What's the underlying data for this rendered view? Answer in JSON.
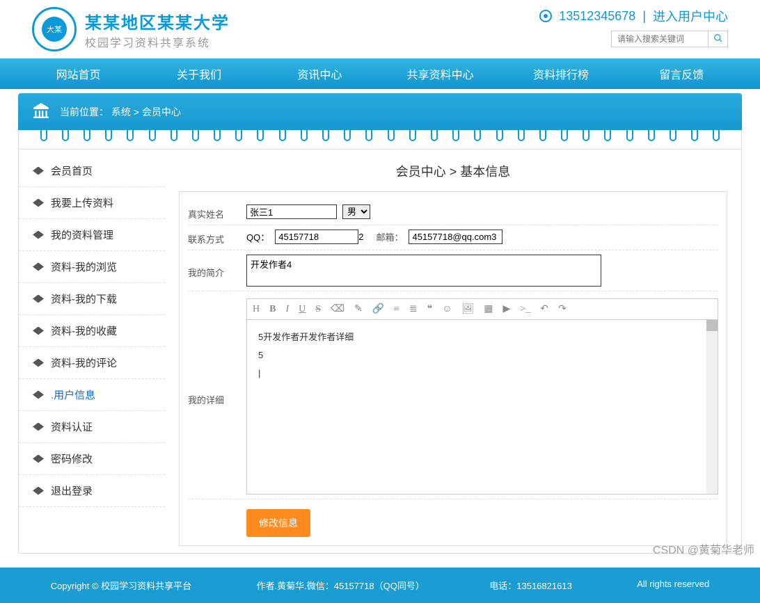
{
  "header": {
    "title_line1": "某某地区某某大学",
    "title_line2": "校园学习资料共享系统",
    "phone": "13512345678",
    "user_center": "进入用户中心",
    "search_placeholder": "请输入搜索关键词"
  },
  "nav": [
    "网站首页",
    "关于我们",
    "资讯中心",
    "共享资料中心",
    "资料排行榜",
    "留言反馈"
  ],
  "breadcrumb": {
    "label": "当前位置：",
    "path": "系统 > 会员中心"
  },
  "sidebar": {
    "items": [
      {
        "label": "会员首页"
      },
      {
        "label": "我要上传资料"
      },
      {
        "label": "我的资料管理"
      },
      {
        "label": "资料-我的浏览"
      },
      {
        "label": "资料-我的下载"
      },
      {
        "label": "资料-我的收藏"
      },
      {
        "label": "资料-我的评论"
      },
      {
        "label": ".用户信息",
        "active": true
      },
      {
        "label": "资料认证"
      },
      {
        "label": "密码修改"
      },
      {
        "label": "退出登录"
      }
    ]
  },
  "page": {
    "title": "会员中心 > 基本信息"
  },
  "form": {
    "name_label": "真实姓名",
    "name_value": "张三1",
    "gender_value": "男",
    "contact_label": "联系方式",
    "qq_label": "QQ：",
    "qq_value": "45157718",
    "qq_suffix": "2",
    "email_label": "邮箱：",
    "email_value": "45157718@qq.com3",
    "intro_label": "我的简介",
    "intro_value": "开发作者4",
    "detail_label": "我的详细",
    "detail_value": "5开发作者开发作者详细\n5\n|",
    "submit": "修改信息"
  },
  "footer": {
    "copyright": "Copyright © 校园学习资料共享平台",
    "author": "作者.黄菊华.微信：45157718（QQ同号）",
    "tel": "电话：13516821613",
    "rights": "All rights reserved"
  },
  "watermark": "CSDN @黄菊华老师"
}
